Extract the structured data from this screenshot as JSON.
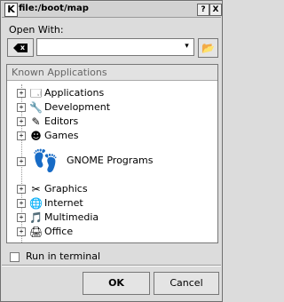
{
  "window": {
    "title": "file:/boot/map",
    "app_icon": "K",
    "help_btn": "?",
    "close_btn": "X"
  },
  "dialog": {
    "open_with_label": "Open With:",
    "clear_button": "x",
    "combo_value": "",
    "combo_arrow": "▾",
    "browse_icon": "📂"
  },
  "list": {
    "header": "Known Applications",
    "items": [
      {
        "label": "Applications",
        "icon": "🗔",
        "expander": "+"
      },
      {
        "label": "Development",
        "icon": "🔧",
        "expander": "+"
      },
      {
        "label": "Editors",
        "icon": "✎",
        "expander": "+"
      },
      {
        "label": "Games",
        "icon": "☻",
        "expander": "+"
      },
      {
        "label": "GNOME Programs",
        "icon": "👣",
        "expander": "+"
      },
      {
        "label": "Graphics",
        "icon": "✂",
        "expander": "+"
      },
      {
        "label": "Internet",
        "icon": "🌐",
        "expander": "+"
      },
      {
        "label": "Multimedia",
        "icon": "🎵",
        "expander": "+"
      },
      {
        "label": "Office",
        "icon": "🖨",
        "expander": "+"
      }
    ]
  },
  "options": {
    "run_in_terminal": "Run in terminal"
  },
  "buttons": {
    "ok": "OK",
    "cancel": "Cancel"
  }
}
